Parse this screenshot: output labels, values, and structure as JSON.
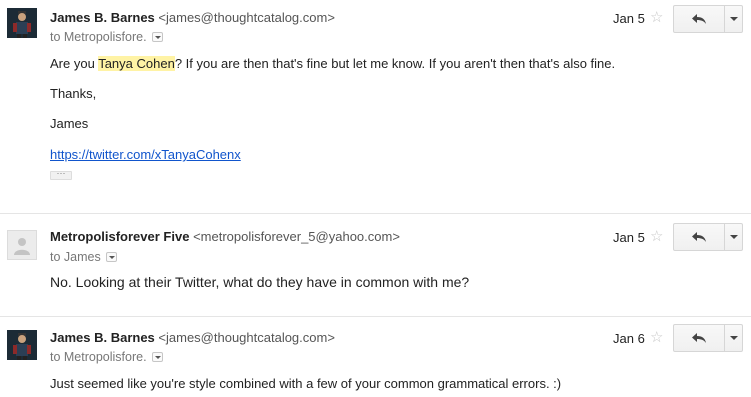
{
  "messages": [
    {
      "sender_name": "James B. Barnes",
      "sender_email": "<james@thoughtcatalog.com>",
      "to_line": "to Metropolisfore.",
      "date": "Jan 5",
      "body": {
        "line1_pre": "Are you ",
        "line1_highlight": "Tanya Cohen",
        "line1_post": "? If you are then that's fine but let me know.  If you aren't then that's also fine.",
        "line2": "Thanks,",
        "line3": "James",
        "link": "https://twitter.com/xTanyaCohenx",
        "ellipsis": "···"
      }
    },
    {
      "sender_name": "Metropolisforever Five",
      "sender_email": "<metropolisforever_5@yahoo.com>",
      "to_line": "to James",
      "date": "Jan 5",
      "body": {
        "line1": "No.  Looking at their Twitter, what do they have in common with me?"
      }
    },
    {
      "sender_name": "James B. Barnes",
      "sender_email": "<james@thoughtcatalog.com>",
      "to_line": "to Metropolisfore.",
      "date": "Jan 6",
      "body": {
        "line1": "Just seemed like you're style combined with a few of your common grammatical errors. :)"
      }
    }
  ],
  "icons": {
    "star": "star-icon",
    "reply": "reply-icon",
    "more": "chevron-down-icon"
  },
  "colors": {
    "highlight": "#fff3a5",
    "link": "#1155cc"
  }
}
